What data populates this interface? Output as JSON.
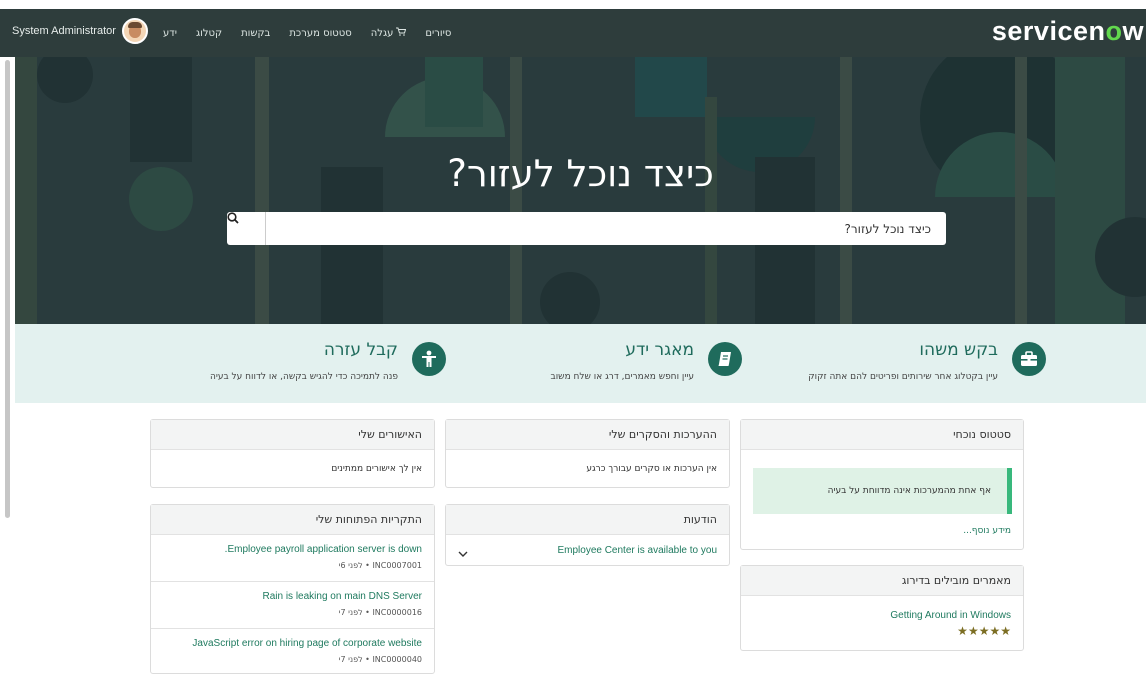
{
  "nav": {
    "user_name": "System Administrator",
    "links": [
      "ידע",
      "קטלוג",
      "בקשות",
      "סטטוס מערכת",
      "עגלה",
      "סיורים"
    ],
    "logo_prefix": "servicen",
    "logo_o": "o",
    "logo_suffix": "w"
  },
  "hero": {
    "title": "כיצד נוכל לעזור?",
    "search_placeholder": "כיצד נוכל לעזור?"
  },
  "quick_links": [
    {
      "title": "בקש משהו",
      "description": "עיין בקטלוג אחר שירותים ופריטים להם אתה זקוק",
      "icon": "briefcase-icon"
    },
    {
      "title": "מאגר ידע",
      "description": "עיין וחפש מאמרים, דרג או שלח משוב",
      "icon": "book-icon"
    },
    {
      "title": "קבל עזרה",
      "description": "פנה לתמיכה כדי להגיש בקשה, או לדווח על בעיה",
      "icon": "person-icon"
    }
  ],
  "panels": {
    "status": {
      "title": "סטטוס נוכחי",
      "message": "אף אחת מהמערכות אינה מדווחת על בעיה",
      "more": "מידע נוסף..."
    },
    "top_articles": {
      "title": "מאמרים מובילים בדירוג",
      "article": "Getting Around in Windows",
      "rating": 5
    },
    "surveys": {
      "title": "ההערכות והסקרים שלי",
      "empty": "אין הערכות או סקרים עבורך כרגע"
    },
    "announcements": {
      "title": "הודעות",
      "item": "Employee Center is available to you"
    },
    "approvals": {
      "title": "האישורים שלי",
      "empty": "אין לך אישורים ממתינים"
    },
    "incidents": {
      "title": "התקריות הפתוחות שלי",
      "items": [
        {
          "title": "Employee payroll application server is down.",
          "meta": "INC0007001 • לפני 6י"
        },
        {
          "title": "Rain is leaking on main DNS Server",
          "meta": "INC0000016 • לפני 7י"
        },
        {
          "title": "JavaScript error on hiring page of corporate website",
          "meta": "INC0000040 • לפני 7י"
        }
      ]
    }
  },
  "colors": {
    "accent": "#1f6b5c",
    "navbar": "#2e3d3c",
    "hero": "#293b3d",
    "status_ok": "#38b87c"
  }
}
